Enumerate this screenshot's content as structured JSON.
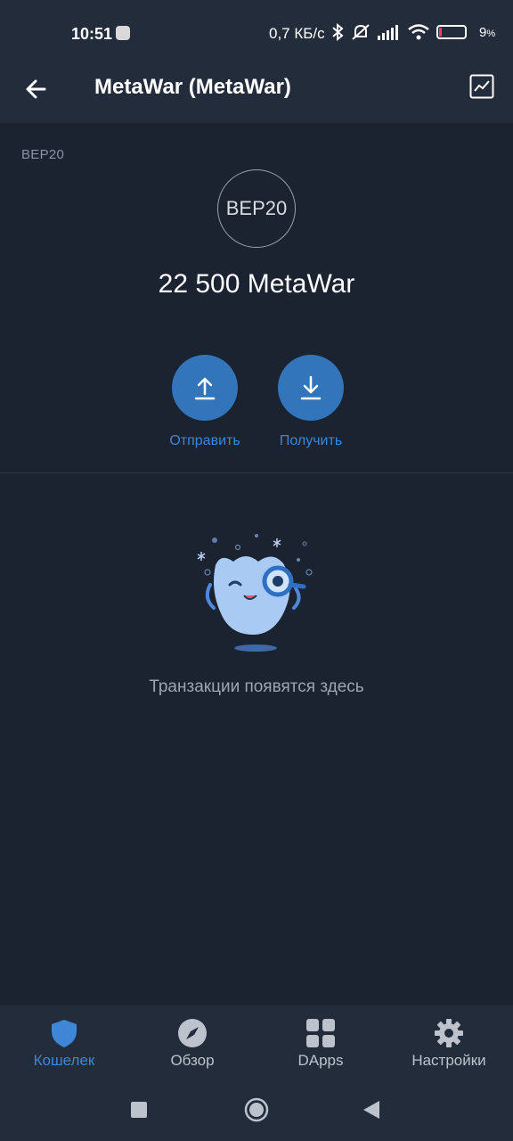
{
  "status_bar": {
    "time": "10:51",
    "net_speed": "0,7 КБ/с",
    "battery_pct": "9",
    "battery_level": 0.09
  },
  "header": {
    "title": "MetaWar (MetaWar)"
  },
  "token": {
    "network": "BEP20",
    "logo_text": "BEP20",
    "balance": "22 500 MetaWar"
  },
  "actions": {
    "send_label": "Отправить",
    "receive_label": "Получить"
  },
  "empty_state": {
    "message": "Транзакции появятся здесь"
  },
  "bottom_nav": {
    "items": [
      {
        "label": "Кошелек",
        "icon": "shield-icon",
        "active": true
      },
      {
        "label": "Обзор",
        "icon": "compass-icon",
        "active": false
      },
      {
        "label": "DApps",
        "icon": "grid-icon",
        "active": false
      },
      {
        "label": "Настройки",
        "icon": "gear-icon",
        "active": false
      }
    ]
  },
  "colors": {
    "background": "#1b2230",
    "bar": "#232c3b",
    "accent": "#3375bb",
    "accent_text": "#3f86d6"
  }
}
